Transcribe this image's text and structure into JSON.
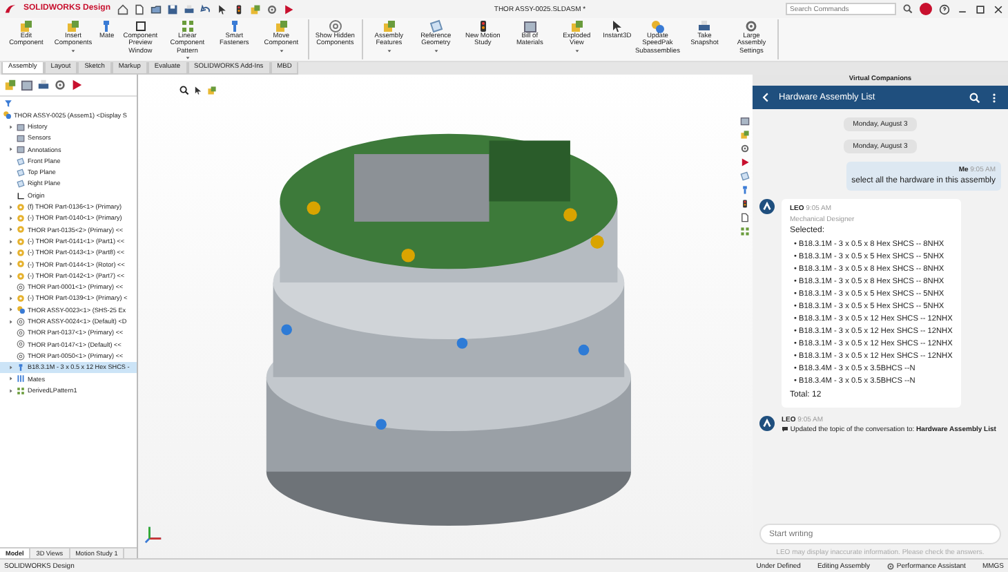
{
  "app": {
    "logo_text": "SOLIDWORKS Design",
    "title": "THOR ASSY-0025.SLDASM *",
    "search": {
      "placeholder": "Search Commands"
    }
  },
  "ribbon": [
    {
      "buttons": [
        {
          "label": "Edit Component",
          "has_menu": false
        },
        {
          "label": "Insert Components",
          "has_menu": true
        },
        {
          "label": "Mate",
          "has_menu": false
        },
        {
          "label": "Component Preview Window",
          "has_menu": false
        },
        {
          "label": "Linear Component Pattern",
          "has_menu": true
        },
        {
          "label": "Smart Fasteners",
          "has_menu": false
        },
        {
          "label": "Move Component",
          "has_menu": true
        }
      ]
    },
    {
      "buttons": [
        {
          "label": "Show Hidden Components",
          "has_menu": false
        }
      ]
    },
    {
      "buttons": [
        {
          "label": "Assembly Features",
          "has_menu": true
        },
        {
          "label": "Reference Geometry",
          "has_menu": true
        },
        {
          "label": "New Motion Study",
          "has_menu": false
        },
        {
          "label": "Bill of Materials",
          "has_menu": false
        },
        {
          "label": "Exploded View",
          "has_menu": true
        },
        {
          "label": "Instant3D",
          "has_menu": false
        },
        {
          "label": "Update SpeedPak Subassemblies",
          "has_menu": false
        },
        {
          "label": "Take Snapshot",
          "has_menu": false
        },
        {
          "label": "Large Assembly Settings",
          "has_menu": false
        }
      ]
    }
  ],
  "command_tabs": [
    {
      "label": "Assembly",
      "selected": true
    },
    {
      "label": "Layout",
      "selected": false
    },
    {
      "label": "Sketch",
      "selected": false
    },
    {
      "label": "Markup",
      "selected": false
    },
    {
      "label": "Evaluate",
      "selected": false
    },
    {
      "label": "SOLIDWORKS Add-Ins",
      "selected": false
    },
    {
      "label": "MBD",
      "selected": false
    }
  ],
  "tree": {
    "label": "THOR ASSY-0025 (Assem1) <Display S",
    "kind": "assembly",
    "selected": false,
    "children": [
      {
        "label": "History",
        "kind": "folder",
        "expandable": true,
        "selected": false
      },
      {
        "label": "Sensors",
        "kind": "folder",
        "expandable": false,
        "selected": false
      },
      {
        "label": "Annotations",
        "kind": "folder",
        "expandable": true,
        "selected": false
      },
      {
        "label": "Front Plane",
        "kind": "plane",
        "expandable": false,
        "selected": false
      },
      {
        "label": "Top Plane",
        "kind": "plane",
        "expandable": false,
        "selected": false
      },
      {
        "label": "Right Plane",
        "kind": "plane",
        "expandable": false,
        "selected": false
      },
      {
        "label": "Origin",
        "kind": "origin",
        "expandable": false,
        "selected": false
      },
      {
        "label": "(f) THOR Part-0136<1> (Primary)",
        "kind": "part",
        "expandable": true,
        "selected": false
      },
      {
        "label": "(-) THOR Part-0140<1> (Primary)",
        "kind": "part",
        "expandable": true,
        "selected": false
      },
      {
        "label": "THOR Part-0135<2> (Primary) <<",
        "kind": "part",
        "expandable": true,
        "selected": false
      },
      {
        "label": "(-) THOR Part-0141<1> (Part1) <<",
        "kind": "part",
        "expandable": true,
        "selected": false
      },
      {
        "label": "(-) THOR Part-0143<1> (Part8) <<",
        "kind": "part",
        "expandable": true,
        "selected": false
      },
      {
        "label": "(-) THOR Part-0144<1> (Rotor) <<",
        "kind": "part",
        "expandable": true,
        "selected": false
      },
      {
        "label": "(-) THOR Part-0142<1> (Part7) <<",
        "kind": "part",
        "expandable": true,
        "selected": false
      },
      {
        "label": "THOR Part-0001<1> (Primary) <<",
        "kind": "hidden-part",
        "expandable": false,
        "selected": false
      },
      {
        "label": "(-) THOR Part-0139<1> (Primary) <",
        "kind": "part",
        "expandable": true,
        "selected": false
      },
      {
        "label": "THOR ASSY-0023<1> (SHS-25 Ex",
        "kind": "subassembly",
        "expandable": true,
        "selected": false
      },
      {
        "label": "THOR ASSY-0024<1> (Default) <D",
        "kind": "hidden-part",
        "expandable": true,
        "selected": false
      },
      {
        "label": "THOR Part-0137<1> (Primary) <<",
        "kind": "hidden-part",
        "expandable": false,
        "selected": false
      },
      {
        "label": "THOR Part-0147<1> (Default) <<",
        "kind": "hidden-part",
        "expandable": false,
        "selected": false
      },
      {
        "label": "THOR Part-0050<1> (Primary) <<",
        "kind": "hidden-part",
        "expandable": false,
        "selected": false
      },
      {
        "label": "B18.3.1M - 3 x 0.5 x 12 Hex SHCS -",
        "kind": "fastener",
        "expandable": true,
        "selected": true
      },
      {
        "label": "Mates",
        "kind": "mates",
        "expandable": true,
        "selected": false
      },
      {
        "label": "DerivedLPattern1",
        "kind": "pattern",
        "expandable": true,
        "selected": false
      }
    ]
  },
  "model_tabs": [
    {
      "label": "Model",
      "selected": true
    },
    {
      "label": "3D Views",
      "selected": false
    },
    {
      "label": "Motion Study 1",
      "selected": false
    }
  ],
  "companion": {
    "panel_title": "Virtual Companions",
    "conversation_title": "Hardware Assembly List",
    "messages": [
      {
        "kind": "date",
        "text": "Monday, August 3"
      },
      {
        "kind": "date",
        "text": "Monday, August 3"
      },
      {
        "kind": "user",
        "author": "Me",
        "time": "9:05 AM",
        "text": "select all the hardware in this assembly"
      },
      {
        "kind": "agent",
        "author": "LEO",
        "time": "9:05 AM",
        "role": "Mechanical Designer",
        "intro": "Selected:",
        "items": [
          "• B18.3.1M - 3 x 0.5 x 8 Hex SHCS -- 8NHX",
          "• B18.3.1M - 3 x 0.5 x 5 Hex SHCS -- 5NHX",
          "• B18.3.1M - 3 x 0.5 x 8 Hex SHCS -- 8NHX",
          "• B18.3.1M - 3 x 0.5 x 8 Hex SHCS -- 8NHX",
          "• B18.3.1M - 3 x 0.5 x 5 Hex SHCS -- 5NHX",
          "• B18.3.1M - 3 x 0.5 x 5 Hex SHCS -- 5NHX",
          "• B18.3.1M - 3 x 0.5 x 12 Hex SHCS -- 12NHX",
          "• B18.3.1M - 3 x 0.5 x 12 Hex SHCS -- 12NHX",
          "• B18.3.1M - 3 x 0.5 x 12 Hex SHCS -- 12NHX",
          "• B18.3.1M - 3 x 0.5 x 12 Hex SHCS -- 12NHX",
          "• B18.3.4M - 3 x 0.5 x 3.5BHCS --N",
          "• B18.3.4M - 3 x 0.5 x 3.5BHCS --N"
        ],
        "total": "Total: 12"
      },
      {
        "kind": "notice",
        "author": "LEO",
        "time": "9:05 AM",
        "text": "Updated the topic of the conversation to: **Hardware Assembly List**"
      }
    ],
    "input": {
      "placeholder": "Start writing"
    },
    "disclaimer": "LEO may display inaccurate information. Please check the answers."
  },
  "status_bar": {
    "app_name": "SOLIDWORKS Design",
    "state": "Under Defined",
    "mode": "Editing Assembly",
    "assistant": "Performance Assistant",
    "units": "MMGS"
  }
}
